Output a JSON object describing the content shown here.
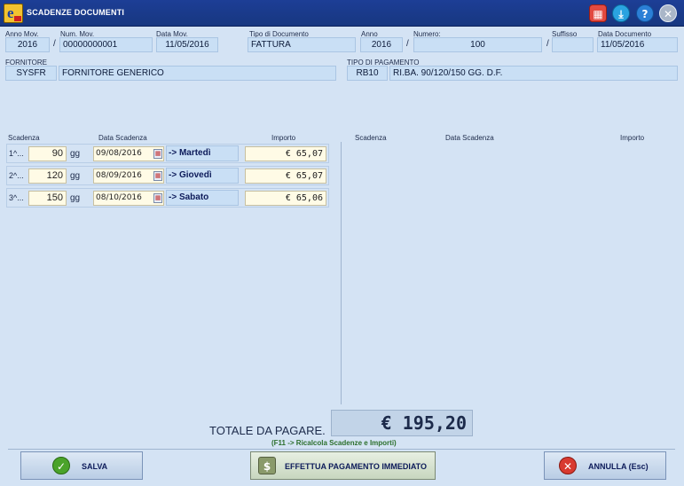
{
  "window": {
    "title": "SCADENZE DOCUMENTI"
  },
  "toolbar": {
    "calc_icon": "calculator-icon",
    "download_icon": "download-icon",
    "help_icon": "help-icon",
    "close_icon": "close-icon"
  },
  "header": {
    "anno_mov_label": "Anno Mov.",
    "anno_mov": "2016",
    "num_mov_label": "Num. Mov.",
    "num_mov": "00000000001",
    "data_mov_label": "Data Mov.",
    "data_mov": "11/05/2016",
    "tipo_doc_label": "Tipo di Documento",
    "tipo_doc": "FATTURA",
    "anno_label": "Anno",
    "anno": "2016",
    "numero_label": "Numero:",
    "numero": "100",
    "suffisso_label": "Suffisso",
    "suffisso": "",
    "data_doc_label": "Data Documento",
    "data_doc": "11/05/2016",
    "slash": "/"
  },
  "supplier": {
    "label": "FORNITORE",
    "code": "SYSFR",
    "name": "FORNITORE GENERICO"
  },
  "payment": {
    "label": "TIPO DI PAGAMENTO",
    "code": "RB10",
    "description": "RI.BA. 90/120/150 GG. D.F."
  },
  "columns_left": {
    "scadenza": "Scadenza",
    "data": "Data Scadenza",
    "importo": "Importo"
  },
  "columns_right": {
    "scadenza": "Scadenza",
    "data": "Data Scadenza",
    "importo": "Importo"
  },
  "rows": [
    {
      "ord": "1^...",
      "days": "90",
      "unit": "gg",
      "date": "09/08/2016",
      "day": "-> Martedì",
      "amount": "€ 65,07"
    },
    {
      "ord": "2^...",
      "days": "120",
      "unit": "gg",
      "date": "08/09/2016",
      "day": "-> Giovedì",
      "amount": "€ 65,07"
    },
    {
      "ord": "3^...",
      "days": "150",
      "unit": "gg",
      "date": "08/10/2016",
      "day": "-> Sabato",
      "amount": "€ 65,06"
    }
  ],
  "totals": {
    "label": "TOTALE DA PAGARE.",
    "value": "€ 195,20",
    "hint": "(F11 -> Ricalcola Scadenze e Importi)"
  },
  "buttons": {
    "save": "SALVA",
    "pay": "EFFETTUA PAGAMENTO IMMEDIATO",
    "cancel": "ANNULLA (Esc)"
  }
}
